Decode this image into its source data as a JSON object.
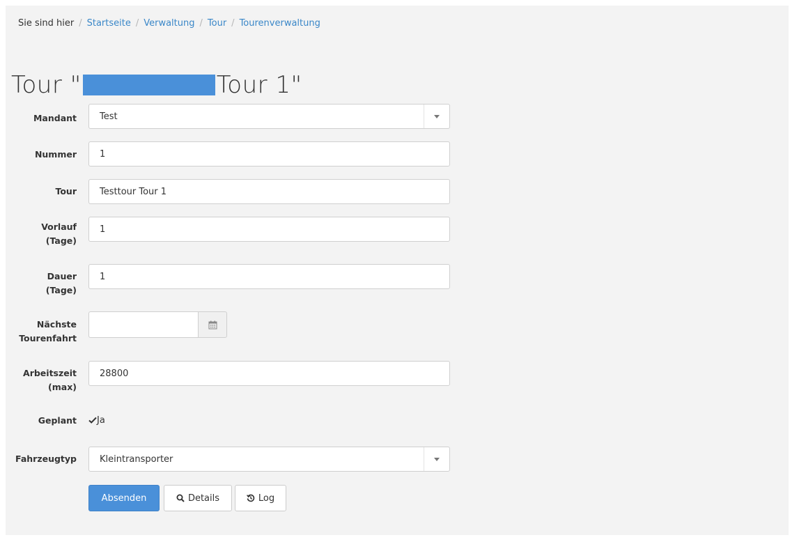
{
  "breadcrumb": {
    "prefix": "Sie sind hier",
    "items": [
      "Startseite",
      "Verwaltung",
      "Tour",
      "Tourenverwaltung"
    ]
  },
  "title": {
    "prefix": "Tour \"",
    "suffix": "Tour 1\""
  },
  "form": {
    "mandant": {
      "label": "Mandant",
      "value": "Test"
    },
    "nummer": {
      "label": "Nummer",
      "value": "1"
    },
    "tour": {
      "label": "Tour",
      "value": "Testtour Tour 1"
    },
    "vorlauf": {
      "label_line1": "Vorlauf",
      "label_line2": "(Tage)",
      "value": "1"
    },
    "dauer": {
      "label_line1": "Dauer",
      "label_line2": "(Tage)",
      "value": "1"
    },
    "naechste": {
      "label_line1": "Nächste",
      "label_line2": "Tourenfahrt",
      "value": ""
    },
    "arbeitszeit": {
      "label_line1": "Arbeitszeit",
      "label_line2": "(max)",
      "value": "28800"
    },
    "geplant": {
      "label": "Geplant",
      "value": "Ja"
    },
    "fahrzeugtyp": {
      "label": "Fahrzeugtyp",
      "value": "Kleintransporter"
    }
  },
  "buttons": {
    "submit": "Absenden",
    "details": "Details",
    "log": "Log"
  },
  "colors": {
    "accent": "#4a90d9",
    "link": "#3a87c8",
    "panel": "#f3f3f3"
  }
}
